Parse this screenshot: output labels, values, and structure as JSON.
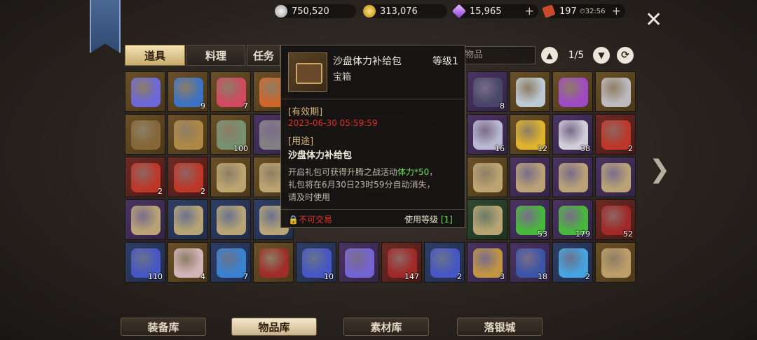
{
  "currency": {
    "silver": "750,520",
    "gold": "313,076",
    "diamond": "15,965",
    "ticket": "197",
    "ticket_timer": "32:56"
  },
  "tabs": [
    "道具",
    "料理",
    "任务"
  ],
  "search_placeholder": "物品",
  "pager": "1/5",
  "tooltip": {
    "name": "沙盘体力补给包",
    "level": "等级1",
    "type": "宝箱",
    "validity_label": "[有效期]",
    "validity_value": "2023-06-30 05:59:59",
    "usage_label": "[用途]",
    "usage_value": "沙盘体力补给包",
    "desc_line1_pre": "开启礼包可获得升腾之战活动",
    "desc_highlight": "体力*50",
    "desc_line1_post": "，",
    "desc_line2": "礼包将在6月30日23时59分自动消失，",
    "desc_line3": "请及时使用",
    "trade": "不可交易",
    "use_level_label": "使用等级",
    "use_level_value": "[1]"
  },
  "grid": [
    [
      {
        "q": "gold",
        "c": "",
        "art": "blue-scroll"
      },
      {
        "q": "gold",
        "c": "9",
        "art": "blue-card"
      },
      {
        "q": "gold",
        "c": "7",
        "art": "lollipop"
      },
      {
        "q": "gold",
        "c": "",
        "art": "carrot"
      },
      {
        "q": "",
        "c": "",
        "art": ""
      },
      {
        "q": "",
        "c": "",
        "art": ""
      },
      {
        "q": "",
        "c": "",
        "art": ""
      },
      {
        "q": "",
        "c": "",
        "art": ""
      },
      {
        "q": "purple",
        "c": "8",
        "art": "dark-emblem"
      },
      {
        "q": "gold",
        "c": "",
        "art": "crystal"
      },
      {
        "q": "gold",
        "c": "",
        "art": "purple-crystal"
      },
      {
        "q": "gold",
        "c": "",
        "art": "silver-crystal"
      }
    ],
    [
      {
        "q": "gold",
        "c": "",
        "art": "chest"
      },
      {
        "q": "gold",
        "c": "",
        "art": "compass"
      },
      {
        "q": "gold",
        "c": "100",
        "art": "dragon-coin"
      },
      {
        "q": "purple",
        "c": "",
        "art": "knight-mask"
      },
      {
        "q": "",
        "c": "",
        "art": ""
      },
      {
        "q": "",
        "c": "",
        "art": ""
      },
      {
        "q": "",
        "c": "",
        "art": ""
      },
      {
        "q": "",
        "c": "",
        "art": ""
      },
      {
        "q": "purple",
        "c": "16",
        "art": "dagger"
      },
      {
        "q": "gold",
        "c": "12",
        "art": "gold-ingot"
      },
      {
        "q": "purple",
        "c": "38",
        "art": "silver-ingot"
      },
      {
        "q": "red",
        "c": "2",
        "art": "puzzle-red"
      }
    ],
    [
      {
        "q": "red",
        "c": "2",
        "art": "puzzle-ru"
      },
      {
        "q": "red",
        "c": "2",
        "art": "puzzle-shan"
      },
      {
        "q": "gold",
        "c": "",
        "art": "map-scroll"
      },
      {
        "q": "gold",
        "c": "",
        "art": "map-scroll"
      },
      {
        "q": "",
        "c": "",
        "art": ""
      },
      {
        "q": "",
        "c": "",
        "art": ""
      },
      {
        "q": "",
        "c": "",
        "art": ""
      },
      {
        "q": "",
        "c": "",
        "art": ""
      },
      {
        "q": "gold",
        "c": "",
        "art": "map-scroll"
      },
      {
        "q": "purple",
        "c": "",
        "art": "map-scroll"
      },
      {
        "q": "purple",
        "c": "",
        "art": "map-scroll"
      },
      {
        "q": "purple",
        "c": "",
        "art": "map-scroll"
      }
    ],
    [
      {
        "q": "purple",
        "c": "",
        "art": "map-scroll"
      },
      {
        "q": "blue",
        "c": "",
        "art": "map-scroll"
      },
      {
        "q": "blue",
        "c": "",
        "art": "map-scroll"
      },
      {
        "q": "blue",
        "c": "",
        "art": "map-scroll"
      },
      {
        "q": "",
        "c": "",
        "art": ""
      },
      {
        "q": "",
        "c": "",
        "art": ""
      },
      {
        "q": "",
        "c": "",
        "art": ""
      },
      {
        "q": "",
        "c": "",
        "art": ""
      },
      {
        "q": "green",
        "c": "",
        "art": "map-scroll"
      },
      {
        "q": "purple",
        "c": "53",
        "art": "green-feather"
      },
      {
        "q": "purple",
        "c": "179",
        "art": "green-feather"
      },
      {
        "q": "red",
        "c": "52",
        "art": "red-ticket"
      }
    ],
    [
      {
        "q": "blue",
        "c": "110",
        "art": "blue-ticket"
      },
      {
        "q": "gold",
        "c": "4",
        "art": "paw-badge"
      },
      {
        "q": "blue",
        "c": "7",
        "art": "blue-puzzle"
      },
      {
        "q": "gold",
        "c": "",
        "art": "red-ticket"
      },
      {
        "q": "blue",
        "c": "10",
        "art": "blue-ticket"
      },
      {
        "q": "purple",
        "c": "",
        "art": "purple-ticket"
      },
      {
        "q": "red",
        "c": "147",
        "art": "red-ticket"
      },
      {
        "q": "blue",
        "c": "2",
        "art": "blue-ticket"
      },
      {
        "q": "purple",
        "c": "3",
        "art": "hook"
      },
      {
        "q": "purple",
        "c": "18",
        "art": "blue-flag"
      },
      {
        "q": "blue",
        "c": "2",
        "art": "blue-orb"
      },
      {
        "q": "gold",
        "c": "",
        "art": "scroll-roll"
      }
    ]
  ],
  "bottom_tabs": [
    "装备库",
    "物品库",
    "素材库",
    "落银城"
  ],
  "colors": {
    "accent_gold": "#c9ab6e",
    "red_text": "#e0302a",
    "green_text": "#6fe05a"
  }
}
